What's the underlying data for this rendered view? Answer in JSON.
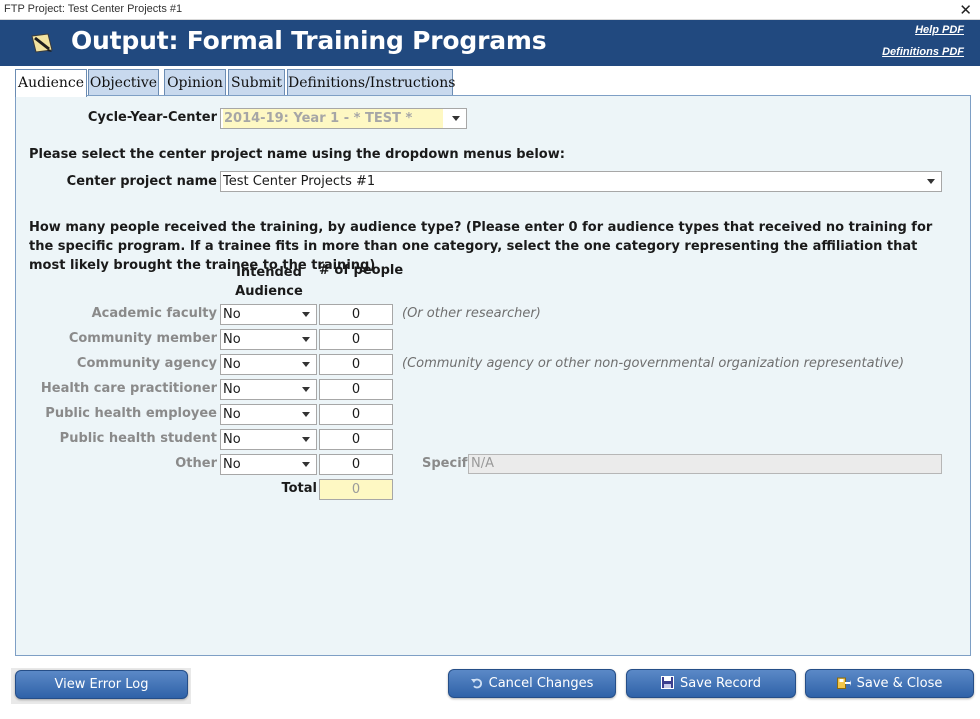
{
  "window": {
    "title": "FTP Project: Test Center Projects #1",
    "close_glyph": "✕"
  },
  "header": {
    "title": "Output: Formal Training Programs",
    "help_link": "Help PDF",
    "definitions_link": "Definitions PDF",
    "logo_icon": "note-pencil-icon"
  },
  "tabs": [
    {
      "label": "Audience",
      "active": true
    },
    {
      "label": "Objective",
      "active": false
    },
    {
      "label": "Opinion",
      "active": false
    },
    {
      "label": "Submit",
      "active": false
    },
    {
      "label": "Definitions/Instructions",
      "active": false
    }
  ],
  "form": {
    "cycle_label": "Cycle-Year-Center",
    "cycle_value": "2014-19: Year 1 - * TEST *",
    "select_prompt": "Please select the center project name using the dropdown menus below:",
    "project_label": "Center project name",
    "project_value": "Test Center Projects #1",
    "question": "How many people received the training, by audience type? (Please enter 0 for audience types that received no training for the specific program. If a trainee fits in more than one category, select the one category representing the affiliation that most likely brought the trainee to the training)",
    "col_intended": "Intended Audience",
    "col_people": "# of people",
    "rows": [
      {
        "label": "Academic faculty",
        "intended": "No",
        "people": "0",
        "note": "(Or other researcher)"
      },
      {
        "label": "Community member",
        "intended": "No",
        "people": "0",
        "note": ""
      },
      {
        "label": "Community agency",
        "intended": "No",
        "people": "0",
        "note": "(Community agency or other non-governmental organization representative)"
      },
      {
        "label": "Health care practitioner",
        "intended": "No",
        "people": "0",
        "note": ""
      },
      {
        "label": "Public health employee",
        "intended": "No",
        "people": "0",
        "note": ""
      },
      {
        "label": "Public health student",
        "intended": "No",
        "people": "0",
        "note": ""
      },
      {
        "label": "Other",
        "intended": "No",
        "people": "0",
        "note": ""
      }
    ],
    "specify_label": "Specify",
    "specify_value": "N/A",
    "total_label": "Total",
    "total_value": "0"
  },
  "buttons": {
    "view_error_log": "View Error Log",
    "cancel_changes": "Cancel Changes",
    "save_record": "Save Record",
    "save_close": "Save & Close"
  },
  "colors": {
    "header": "#21497f",
    "panel": "#edf5f8",
    "highlight": "#fef8c3",
    "button": "#3a6db3"
  }
}
